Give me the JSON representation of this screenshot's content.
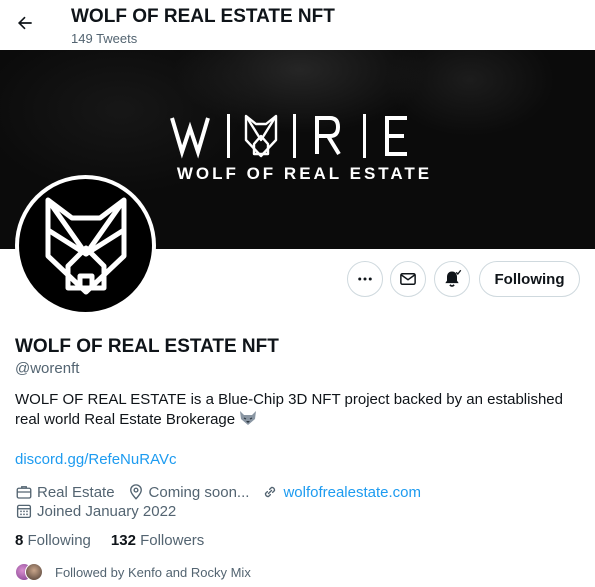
{
  "header": {
    "title": "WOLF OF REAL ESTATE NFT",
    "tweet_count": "149 Tweets"
  },
  "banner": {
    "logo_text": "W|◊|R|E",
    "subtitle": "WOLF OF REAL ESTATE"
  },
  "actions": {
    "following_label": "Following"
  },
  "profile": {
    "name": "WOLF OF REAL ESTATE NFT",
    "handle": "@worenft",
    "bio": "WOLF OF REAL ESTATE is a Blue-Chip 3D NFT project backed by an established real world Real Estate Brokerage",
    "link": "discord.gg/RefeNuRAVc",
    "category": "Real Estate",
    "location": "Coming soon...",
    "website": "wolfofrealestate.com",
    "joined": "Joined January 2022",
    "following_count": "8",
    "following_label": "Following",
    "followers_count": "132",
    "followers_label": "Followers",
    "followed_by": "Followed by Kenfo and Rocky Mix"
  },
  "colors": {
    "accent": "#1d9bf0",
    "text": "#0f1419",
    "muted": "#536471",
    "border": "#cfd9de"
  },
  "icons": [
    "back-arrow-icon",
    "more-icon",
    "mail-icon",
    "bell-icon",
    "briefcase-icon",
    "location-icon",
    "link-icon",
    "calendar-icon",
    "wolf-emoji-icon"
  ]
}
